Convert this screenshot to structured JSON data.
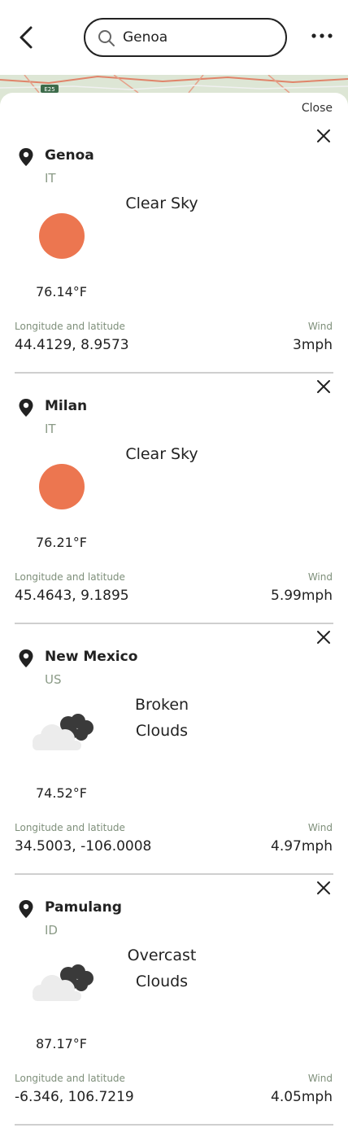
{
  "header": {
    "search_value": "Genoa",
    "back_icon": "chevron-left-icon",
    "search_icon": "search-icon",
    "more_icon": "more-horizontal-icon"
  },
  "map": {
    "road_label": "E25"
  },
  "sheet": {
    "close_label": "Close"
  },
  "labels": {
    "coords": "Longitude and latitude",
    "wind": "Wind"
  },
  "colors": {
    "sun": "#ec7650",
    "muted_green": "#7e8f7a",
    "dark_cloud": "#3a3a3a",
    "light_cloud": "#ececec"
  },
  "cards": [
    {
      "city": "Genoa",
      "country": "IT",
      "description": "Clear Sky",
      "icon": "sun-icon",
      "temperature": "76.14°F",
      "coordinates": "44.4129, 8.9573",
      "wind": "3mph"
    },
    {
      "city": "Milan",
      "country": "IT",
      "description": "Clear Sky",
      "icon": "sun-icon",
      "temperature": "76.21°F",
      "coordinates": "45.4643, 9.1895",
      "wind": "5.99mph"
    },
    {
      "city": "New Mexico",
      "country": "US",
      "description": "Broken Clouds",
      "icon": "broken-clouds-icon",
      "temperature": "74.52°F",
      "coordinates": "34.5003, -106.0008",
      "wind": "4.97mph"
    },
    {
      "city": "Pamulang",
      "country": "ID",
      "description": "Overcast Clouds",
      "icon": "overcast-clouds-icon",
      "temperature": "87.17°F",
      "coordinates": "-6.346, 106.7219",
      "wind": "4.05mph"
    }
  ]
}
